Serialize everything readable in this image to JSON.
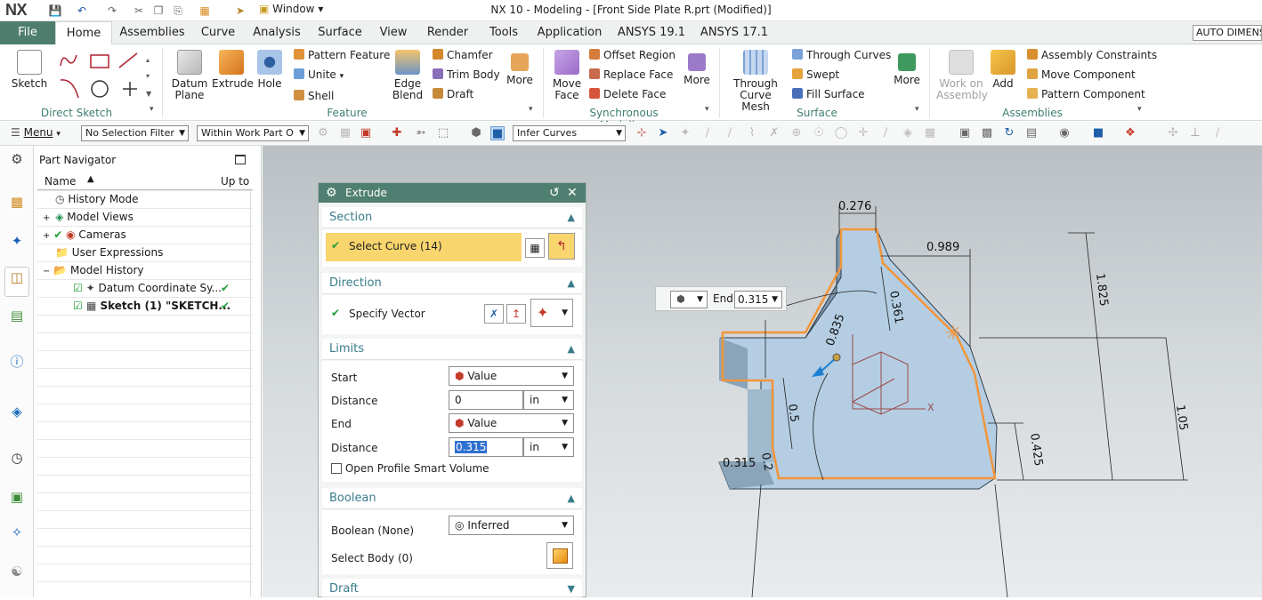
{
  "app": {
    "logo": "NX",
    "title": "NX 10 - Modeling - [Front Side Plate R.prt (Modified)]",
    "window_menu": "Window"
  },
  "tabs": {
    "file": "File",
    "items": [
      "Home",
      "Assemblies",
      "Curve",
      "Analysis",
      "Surface",
      "View",
      "Render",
      "Tools",
      "Application",
      "ANSYS 19.1",
      "ANSYS 17.1"
    ],
    "active": "Home",
    "right_field": "AUTO DIMENSI"
  },
  "ribbon": {
    "sketch": "Sketch",
    "direct_sketch_group": "Direct Sketch",
    "datum_plane": "Datum Plane",
    "extrude": "Extrude",
    "hole": "Hole",
    "pattern_feature": "Pattern Feature",
    "unite": "Unite",
    "shell": "Shell",
    "edge_blend": "Edge Blend",
    "chamfer": "Chamfer",
    "trim_body": "Trim Body",
    "draft": "Draft",
    "more1": "More",
    "feature_group": "Feature",
    "move_face": "Move Face",
    "offset_region": "Offset Region",
    "replace_face": "Replace Face",
    "delete_face": "Delete Face",
    "more2": "More",
    "sync_group": "Synchronous Modeling",
    "through_curve_mesh": "Through Curve Mesh",
    "through_curves": "Through Curves",
    "swept": "Swept",
    "fill_surface": "Fill Surface",
    "more3": "More",
    "surface_group": "Surface",
    "work_on_assembly": "Work on Assembly",
    "add": "Add",
    "assembly_constraints": "Assembly Constraints",
    "move_component": "Move Component",
    "pattern_component": "Pattern Component",
    "assemblies_group": "Assemblies"
  },
  "cmdbar": {
    "menu": "Menu",
    "selection_filter": "No Selection Filter",
    "scope": "Within Work Part O",
    "curve_rule": "Infer Curves"
  },
  "navigator": {
    "title": "Part Navigator",
    "col_name": "Name",
    "col_upto": "Up to",
    "items": [
      "History Mode",
      "Model Views",
      "Cameras",
      "User Expressions",
      "Model History",
      "Datum Coordinate Sy...",
      "Sketch (1) \"SKETCH..."
    ]
  },
  "dialog": {
    "title": "Extrude",
    "section": {
      "header": "Section",
      "select_curve": "Select Curve (14)"
    },
    "direction": {
      "header": "Direction",
      "specify_vector": "Specify Vector"
    },
    "limits": {
      "header": "Limits",
      "start_label": "Start",
      "start_value": "Value",
      "distance_label": "Distance",
      "start_distance": "0",
      "unit": "in",
      "end_label": "End",
      "end_value": "Value",
      "end_distance": "0.315",
      "open_profile": "Open Profile Smart Volume"
    },
    "boolean": {
      "header": "Boolean",
      "boolean_label": "Boolean (None)",
      "boolean_value": "Inferred",
      "select_body": "Select Body (0)"
    },
    "draft": {
      "header": "Draft"
    }
  },
  "float_bar": {
    "label": "End",
    "value": "0.315"
  },
  "dimensions": [
    "0.276",
    "0.989",
    "1.825",
    "0.361",
    "0.835",
    "0.5",
    "1.05",
    "0.425",
    "0.315",
    "0.2"
  ],
  "colors": {
    "accent": "#4e7d6e",
    "highlight": "#f9d56e",
    "check": "#1d9e38",
    "edge": "#f2953a"
  }
}
